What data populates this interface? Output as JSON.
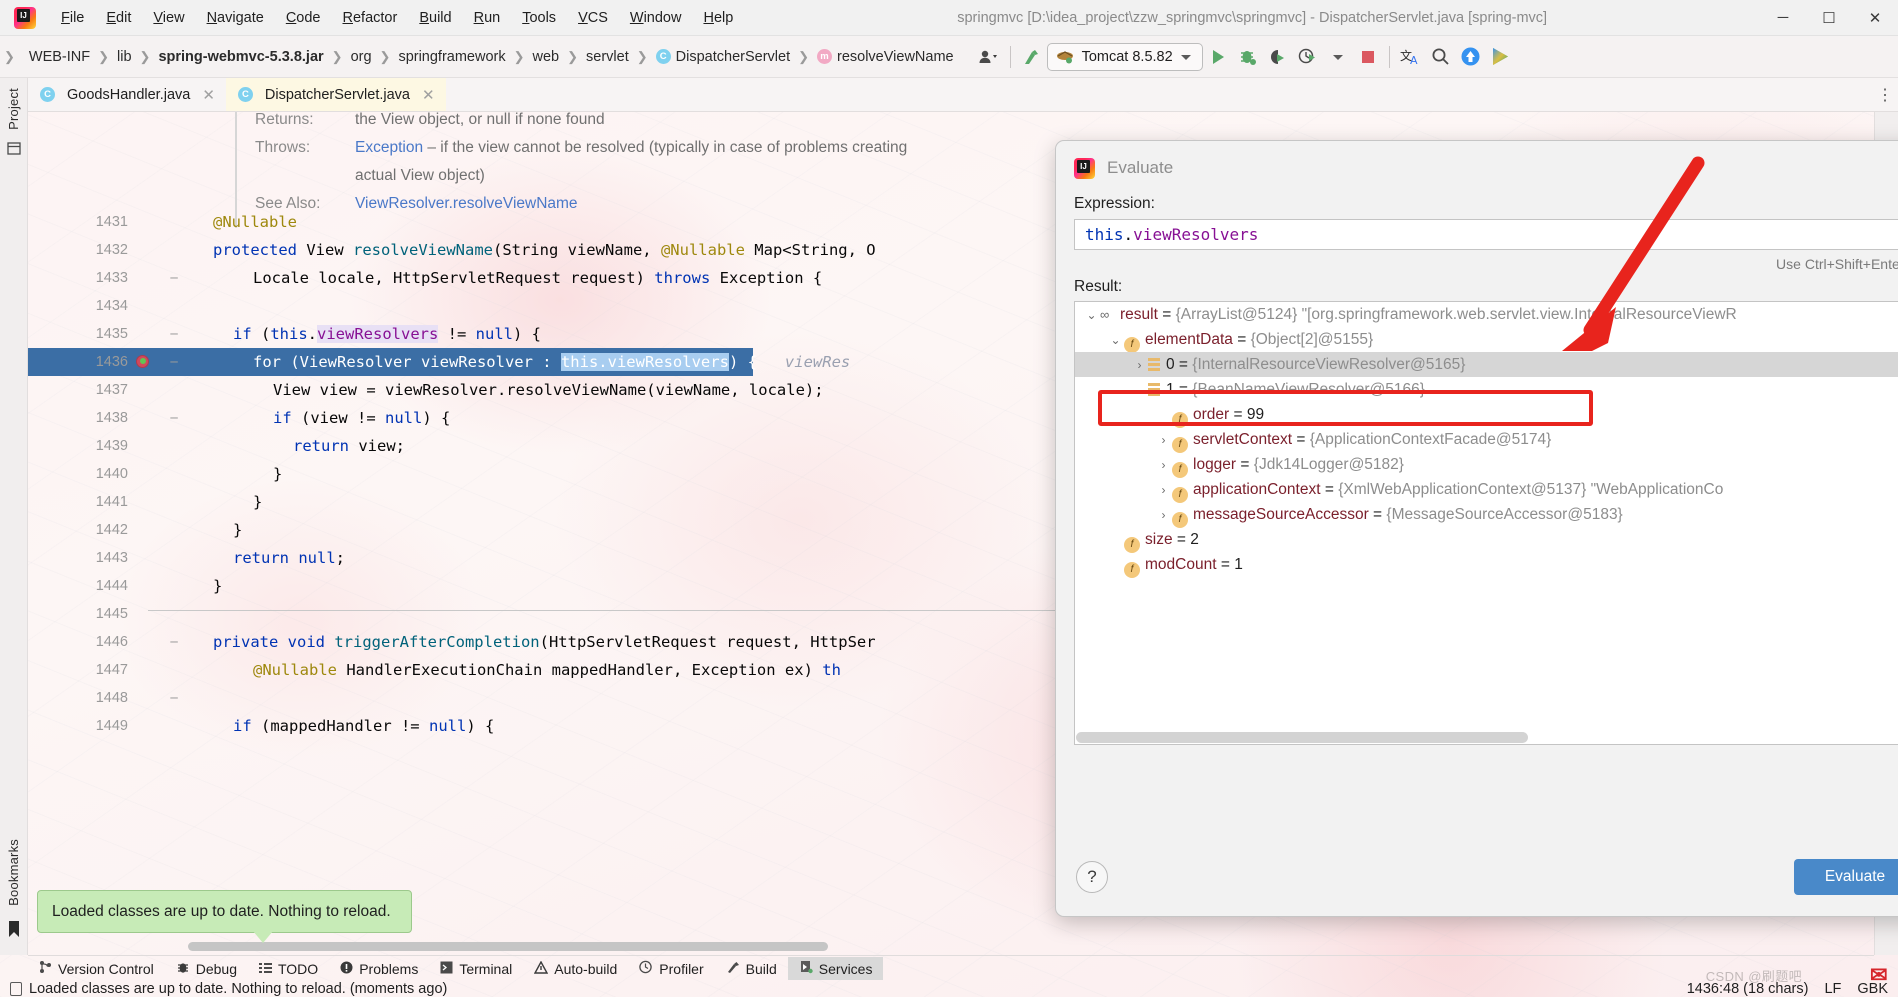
{
  "window": {
    "title": "springmvc [D:\\idea_project\\zzw_springmvc\\springmvc] - DispatcherServlet.java [spring-mvc]",
    "minimize": "─",
    "maximize": "☐",
    "close": "✕"
  },
  "menubar": [
    {
      "label": "File"
    },
    {
      "label": "Edit"
    },
    {
      "label": "View"
    },
    {
      "label": "Navigate"
    },
    {
      "label": "Code"
    },
    {
      "label": "Refactor"
    },
    {
      "label": "Build"
    },
    {
      "label": "Run"
    },
    {
      "label": "Tools"
    },
    {
      "label": "VCS"
    },
    {
      "label": "Window"
    },
    {
      "label": "Help"
    }
  ],
  "breadcrumbs": [
    {
      "label": "WEB-INF",
      "bold": false,
      "badge": ""
    },
    {
      "label": "lib",
      "bold": false,
      "badge": ""
    },
    {
      "label": "spring-webmvc-5.3.8.jar",
      "bold": true,
      "badge": ""
    },
    {
      "label": "org",
      "bold": false,
      "badge": ""
    },
    {
      "label": "springframework",
      "bold": false,
      "badge": ""
    },
    {
      "label": "web",
      "bold": false,
      "badge": ""
    },
    {
      "label": "servlet",
      "bold": false,
      "badge": ""
    },
    {
      "label": "DispatcherServlet",
      "bold": false,
      "badge": "C"
    },
    {
      "label": "resolveViewName",
      "bold": false,
      "badge": "m"
    }
  ],
  "toolbar": {
    "run_config": "Tomcat 8.5.82",
    "icons": [
      {
        "name": "user-dropdown-icon"
      },
      {
        "name": "make-project-icon"
      },
      {
        "name": "run-icon"
      },
      {
        "name": "debug-icon"
      },
      {
        "name": "run-with-coverage-icon"
      },
      {
        "name": "profile-dropdown-icon"
      },
      {
        "name": "stop-icon"
      },
      {
        "name": "translate-icon"
      },
      {
        "name": "search-everywhere-icon"
      },
      {
        "name": "update-project-icon"
      },
      {
        "name": "ide-features-trainer-icon"
      }
    ]
  },
  "tabs": [
    {
      "label": "GoodsHandler.java",
      "active": false,
      "badge": "C",
      "close": "✕"
    },
    {
      "label": "DispatcherServlet.java",
      "active": true,
      "badge": "C",
      "close": "✕"
    }
  ],
  "tabs_more": "⋮",
  "left_strip": {
    "project_label": "Project",
    "bookmarks_label": "Bookmarks"
  },
  "editor": {
    "javadoc": [
      {
        "label": "Returns:",
        "text": "the View object, or null if none found"
      },
      {
        "label": "Throws:",
        "link": "Exception",
        "text": " – if the view cannot be resolved (typically in case of problems creating"
      },
      {
        "label": "",
        "text": "actual View object)"
      },
      {
        "label": "See Also:",
        "link": "ViewResolver.resolveViewName",
        "text": ""
      }
    ],
    "lines": [
      {
        "num": "1431",
        "indent": 1,
        "tokens": [
          {
            "t": "@Nullable",
            "c": "ann"
          }
        ]
      },
      {
        "num": "1432",
        "indent": 1,
        "tokens": [
          {
            "t": "protected ",
            "c": "kw"
          },
          {
            "t": "View ",
            "c": "pln"
          },
          {
            "t": "resolveViewName",
            "c": "mth"
          },
          {
            "t": "(String viewName, ",
            "c": "pln"
          },
          {
            "t": "@Nullable",
            "c": "ann"
          },
          {
            "t": " Map<String, O",
            "c": "pln"
          }
        ]
      },
      {
        "num": "1433",
        "indent": 3,
        "tokens": [
          {
            "t": "Locale locale, HttpServletRequest request) ",
            "c": "pln"
          },
          {
            "t": "throws ",
            "c": "kw"
          },
          {
            "t": "Exception {",
            "c": "pln"
          }
        ]
      },
      {
        "num": "1434",
        "indent": 0,
        "tokens": []
      },
      {
        "num": "1435",
        "indent": 2,
        "tokens": [
          {
            "t": "if ",
            "c": "kw"
          },
          {
            "t": "(",
            "c": "pln"
          },
          {
            "t": "this",
            "c": "kw"
          },
          {
            "t": ".",
            "c": "pln"
          },
          {
            "t": "viewResolvers",
            "c": "hl"
          },
          {
            "t": " != ",
            "c": "pln"
          },
          {
            "t": "null",
            "c": "kw"
          },
          {
            "t": ") {",
            "c": "pln"
          }
        ]
      },
      {
        "num": "1436",
        "indent": 3,
        "breakpoint": true,
        "selected": true,
        "tokens": [
          {
            "t": "for ",
            "c": "w"
          },
          {
            "t": "(ViewResolver viewResolver : ",
            "c": "w"
          },
          {
            "t": "this.viewResolvers",
            "c": "sel-light"
          },
          {
            "t": ") {",
            "c": "w"
          },
          {
            "t": "   viewRes",
            "c": "hintitalic"
          }
        ]
      },
      {
        "num": "1437",
        "indent": 4,
        "tokens": [
          {
            "t": "View view = viewResolver.resolveViewName(viewName, locale);",
            "c": "pln"
          }
        ]
      },
      {
        "num": "1438",
        "indent": 4,
        "tokens": [
          {
            "t": "if ",
            "c": "kw"
          },
          {
            "t": "(view != ",
            "c": "pln"
          },
          {
            "t": "null",
            "c": "kw"
          },
          {
            "t": ") {",
            "c": "pln"
          }
        ]
      },
      {
        "num": "1439",
        "indent": 5,
        "tokens": [
          {
            "t": "return ",
            "c": "kw"
          },
          {
            "t": "view;",
            "c": "pln"
          }
        ]
      },
      {
        "num": "1440",
        "indent": 4,
        "tokens": [
          {
            "t": "}",
            "c": "pln"
          }
        ]
      },
      {
        "num": "1441",
        "indent": 3,
        "tokens": [
          {
            "t": "}",
            "c": "pln"
          }
        ]
      },
      {
        "num": "1442",
        "indent": 2,
        "tokens": [
          {
            "t": "}",
            "c": "pln"
          }
        ]
      },
      {
        "num": "1443",
        "indent": 2,
        "tokens": [
          {
            "t": "return ",
            "c": "kw"
          },
          {
            "t": "null",
            "c": "kw"
          },
          {
            "t": ";",
            "c": "pln"
          }
        ]
      },
      {
        "num": "1444",
        "indent": 1,
        "tokens": [
          {
            "t": "}",
            "c": "pln"
          }
        ]
      },
      {
        "num": "1445",
        "indent": 0,
        "tokens": []
      },
      {
        "num": "1446",
        "indent": 1,
        "tokens": [
          {
            "t": "private void ",
            "c": "kw"
          },
          {
            "t": "triggerAfterCompletion",
            "c": "mth"
          },
          {
            "t": "(HttpServletRequest request, HttpSer",
            "c": "pln"
          }
        ]
      },
      {
        "num": "1447",
        "indent": 3,
        "tokens": [
          {
            "t": "@Nullable",
            "c": "ann"
          },
          {
            "t": " HandlerExecutionChain mappedHandler, Exception ex) ",
            "c": "pln"
          },
          {
            "t": "th",
            "c": "kw"
          }
        ]
      },
      {
        "num": "1448",
        "indent": 0,
        "tokens": []
      },
      {
        "num": "1449",
        "indent": 2,
        "tokens": [
          {
            "t": "if ",
            "c": "kw"
          },
          {
            "t": "(mappedHandler != ",
            "c": "pln"
          },
          {
            "t": "null",
            "c": "kw"
          },
          {
            "t": ") {",
            "c": "pln"
          }
        ]
      }
    ]
  },
  "dialog": {
    "title": "Evaluate",
    "expression_label": "Expression:",
    "expression_value": "this.viewResolvers",
    "shortcut_hint": "Use Ctrl+Shift+Enter to",
    "result_label": "Result:",
    "help_glyph": "?",
    "evaluate_button": "Evaluate",
    "tree": [
      {
        "depth": 0,
        "twisty": "⌄",
        "icon": "glasses",
        "name": "result",
        "eq": " = ",
        "value": "{ArrayList@5124}",
        "extra": " \"[org.springframework.web.servlet.view.InternalResourceViewR",
        "selected": false
      },
      {
        "depth": 1,
        "twisty": "⌄",
        "icon": "f",
        "name": "elementData",
        "eq": " = ",
        "value": "{Object[2]@5155}",
        "extra": "",
        "selected": false
      },
      {
        "depth": 2,
        "twisty": "›",
        "icon": "array",
        "name": "0",
        "eq": " = ",
        "value": "{InternalResourceViewResolver@5165}",
        "extra": "",
        "selected": true
      },
      {
        "depth": 2,
        "twisty": "⌄",
        "icon": "array",
        "name": "1",
        "eq": " = ",
        "value": "{BeanNameViewResolver@5166}",
        "extra": "",
        "selected": false
      },
      {
        "depth": 3,
        "twisty": "",
        "icon": "f",
        "name": "order",
        "eq": " = ",
        "value": "99",
        "extra": "",
        "numeric": true,
        "selected": false
      },
      {
        "depth": 3,
        "twisty": "›",
        "icon": "f",
        "name": "servletContext",
        "eq": " = ",
        "value": "{ApplicationContextFacade@5174}",
        "extra": "",
        "selected": false
      },
      {
        "depth": 3,
        "twisty": "›",
        "icon": "f",
        "name": "logger",
        "eq": " = ",
        "value": "{Jdk14Logger@5182}",
        "extra": "",
        "selected": false
      },
      {
        "depth": 3,
        "twisty": "›",
        "icon": "f",
        "name": "applicationContext",
        "eq": " = ",
        "value": "{XmlWebApplicationContext@5137}",
        "extra": " \"WebApplicationCo",
        "selected": false
      },
      {
        "depth": 3,
        "twisty": "›",
        "icon": "f",
        "name": "messageSourceAccessor",
        "eq": " = ",
        "value": "{MessageSourceAccessor@5183}",
        "extra": "",
        "selected": false
      },
      {
        "depth": 1,
        "twisty": "",
        "icon": "f",
        "name": "size",
        "eq": " = ",
        "value": "2",
        "extra": "",
        "numeric": true,
        "selected": false
      },
      {
        "depth": 1,
        "twisty": "",
        "icon": "f",
        "name": "modCount",
        "eq": " = ",
        "value": "1",
        "extra": "",
        "numeric": true,
        "selected": false
      }
    ]
  },
  "notification": {
    "balloon_text": "Loaded classes are up to date. Nothing to reload."
  },
  "bottom_toolwindows": [
    {
      "label": "Version Control",
      "icon": "branch-icon",
      "active": false
    },
    {
      "label": "Debug",
      "icon": "bug-icon",
      "active": false
    },
    {
      "label": "TODO",
      "icon": "list-icon",
      "active": false
    },
    {
      "label": "Problems",
      "icon": "warning-circle-icon",
      "active": false
    },
    {
      "label": "Terminal",
      "icon": "terminal-icon",
      "active": false
    },
    {
      "label": "Auto-build",
      "icon": "triangle-warning-icon",
      "active": false
    },
    {
      "label": "Profiler",
      "icon": "gauge-icon",
      "active": false
    },
    {
      "label": "Build",
      "icon": "hammer-icon",
      "active": false
    },
    {
      "label": "Services",
      "icon": "services-icon",
      "active": true
    }
  ],
  "statusbar": {
    "message": "Loaded classes are up to date. Nothing to reload. (moments ago)",
    "caret": "1436:48 (18 chars)",
    "line_separator": "LF",
    "encoding": "GBK",
    "watermark": "CSDN @刷题吧"
  },
  "colors": {
    "accent_blue": "#4989c9",
    "selection_blue": "#3b6ea5",
    "annotation_red": "#e8241d",
    "balloon_green": "#c7ebb7",
    "tab_active": "#fdf8e3"
  }
}
